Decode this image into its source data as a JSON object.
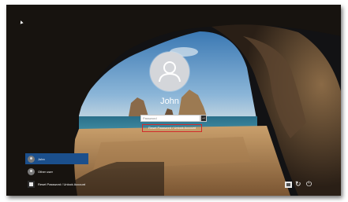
{
  "login": {
    "user_name": "John",
    "password_placeholder": "Password",
    "submit_arrow": "→",
    "reset_link": "Reset Password / Unlock Account"
  },
  "accounts": [
    {
      "label": "John",
      "selected": true
    },
    {
      "label": "Other user",
      "selected": false
    },
    {
      "label": "Reset Password / Unlock Account",
      "selected": false
    }
  ],
  "tray": {
    "network_icon": "network-icon",
    "ease_of_access_icon": "ease-of-access-icon",
    "power_icon": "power-icon",
    "ease_glyph": "↻",
    "power_glyph": "⏻"
  },
  "colors": {
    "selected_account": "#1b4f8c",
    "reset_highlight": "#d22b2b",
    "sky": "#4f8ec2",
    "sea": "#1f5a73",
    "sand": "#b88a55"
  }
}
